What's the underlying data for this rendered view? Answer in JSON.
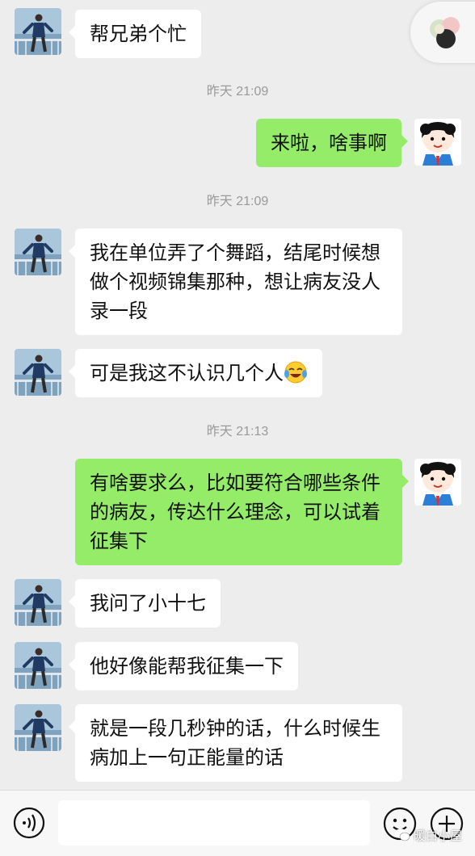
{
  "messages": [
    {
      "text": "帮兄弟个忙"
    },
    {
      "text": "来啦，啥事啊"
    },
    {
      "text": "我在单位弄了个舞蹈，结尾时候想\n做个视频锦集那种，想让病友没人\n录一段"
    },
    {
      "text": "可是我这不认识几个人"
    },
    {
      "text": "有啥要求么，比如要符合哪些条件\n的病友，传达什么理念，可以试着\n征集下"
    },
    {
      "text": "我问了小十七"
    },
    {
      "text": "他好像能帮我征集一下"
    },
    {
      "text": "就是一段几秒钟的话，什么时候生\n病加上一句正能量的话"
    }
  ],
  "timestamps": [
    "昨天 21:09",
    "昨天 21:09",
    "昨天 21:13"
  ],
  "input": {
    "placeholder": ""
  },
  "watermark": "暖白小屋",
  "icons": {
    "voice": "voice-icon",
    "emoji": "emoji-icon",
    "plus": "plus-icon",
    "floater": "multitask-floating-icon"
  },
  "colors": {
    "background": "#ededed",
    "incoming_bubble": "#ffffff",
    "outgoing_bubble": "#95ec69",
    "timestamp": "#9a9a9a"
  }
}
